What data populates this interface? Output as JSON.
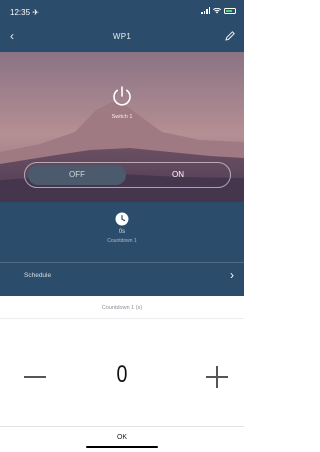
{
  "status_bar": {
    "time": "12:35 ✈"
  },
  "nav": {
    "title": "WP1",
    "back_icon": "chevron-left-icon",
    "edit_icon": "pencil-icon"
  },
  "hero": {
    "switch_name": "Switch 1",
    "power_icon": "power-icon"
  },
  "toggle": {
    "off_label": "OFF",
    "on_label": "ON",
    "selected": "OFF"
  },
  "countdown": {
    "icon": "timer-icon",
    "value": "0s",
    "label": "Countdown 1"
  },
  "schedule": {
    "label": "Schedule",
    "chevron_icon": "chevron-right-icon"
  },
  "sheet": {
    "title": "Countdown 1 (s)",
    "value": "0",
    "ok_label": "OK"
  },
  "colors": {
    "app_bg": "#2b4d6b",
    "battery": "#4cd964",
    "selected_segment": "#4b5a6c"
  }
}
